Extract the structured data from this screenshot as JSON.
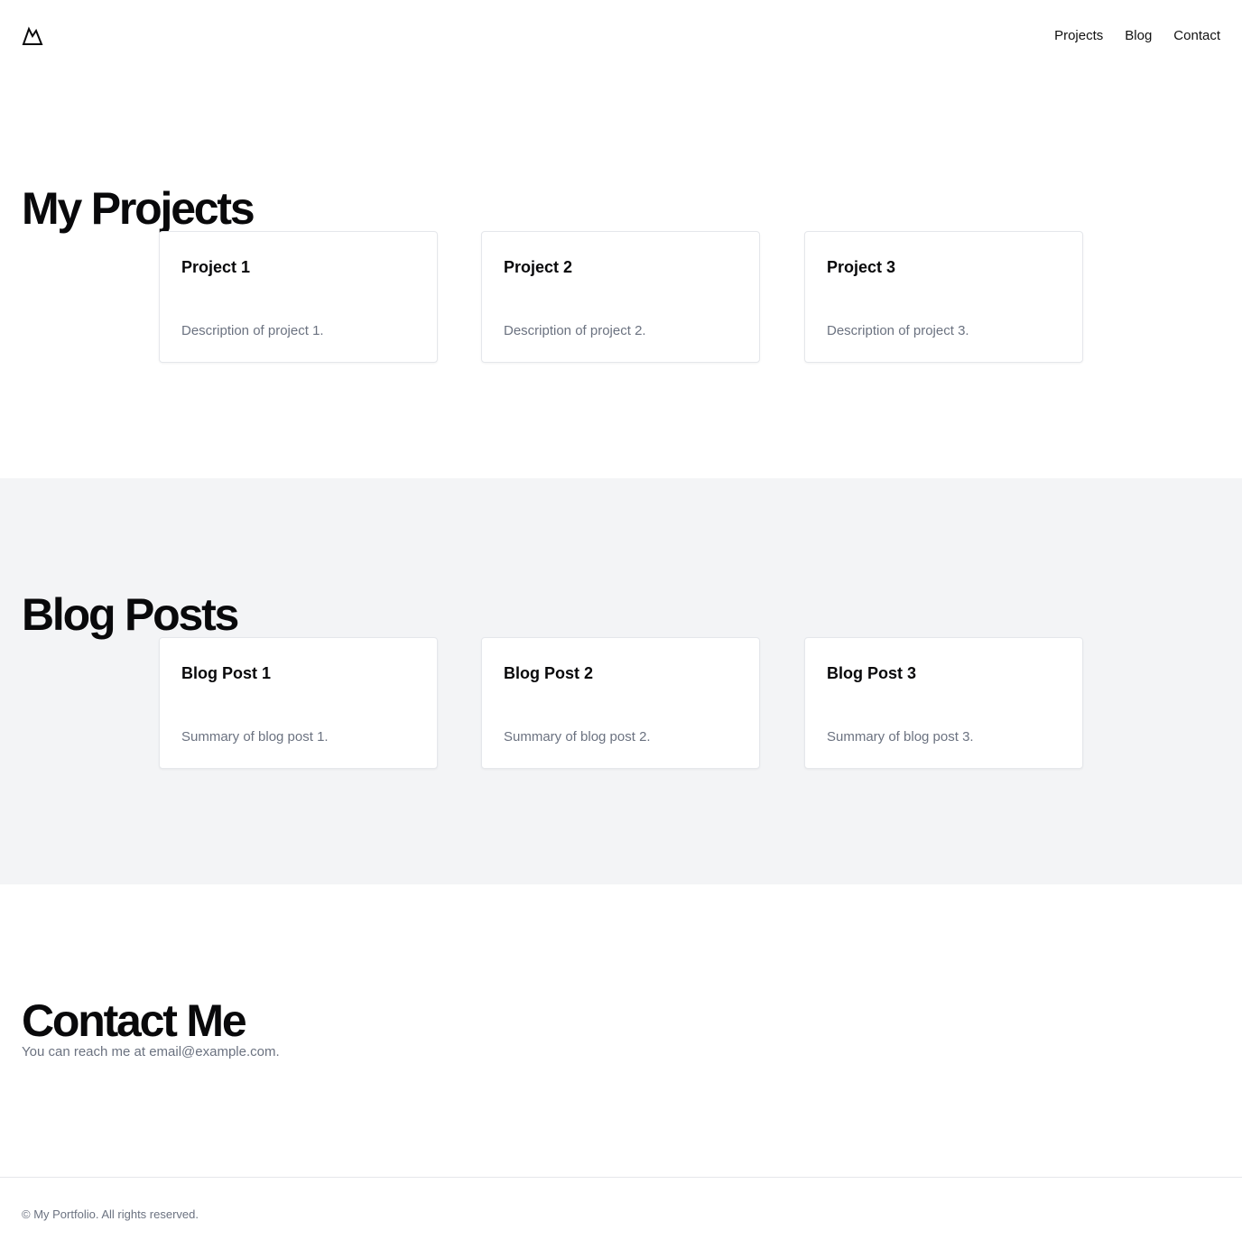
{
  "header": {
    "logo_icon": "mountain-icon",
    "nav": [
      {
        "label": "Projects"
      },
      {
        "label": "Blog"
      },
      {
        "label": "Contact"
      }
    ]
  },
  "projects": {
    "title": "My Projects",
    "items": [
      {
        "title": "Project 1",
        "description": "Description of project 1."
      },
      {
        "title": "Project 2",
        "description": "Description of project 2."
      },
      {
        "title": "Project 3",
        "description": "Description of project 3."
      }
    ]
  },
  "blog": {
    "title": "Blog Posts",
    "items": [
      {
        "title": "Blog Post 1",
        "summary": "Summary of blog post 1."
      },
      {
        "title": "Blog Post 2",
        "summary": "Summary of blog post 2."
      },
      {
        "title": "Blog Post 3",
        "summary": "Summary of blog post 3."
      }
    ]
  },
  "contact": {
    "title": "Contact Me",
    "text": "You can reach me at email@example.com."
  },
  "footer": {
    "text": "© My Portfolio. All rights reserved."
  },
  "colors": {
    "text_primary": "#09090b",
    "text_muted": "#6b7280",
    "blog_background": "#f3f4f6",
    "border": "#e5e7eb"
  }
}
